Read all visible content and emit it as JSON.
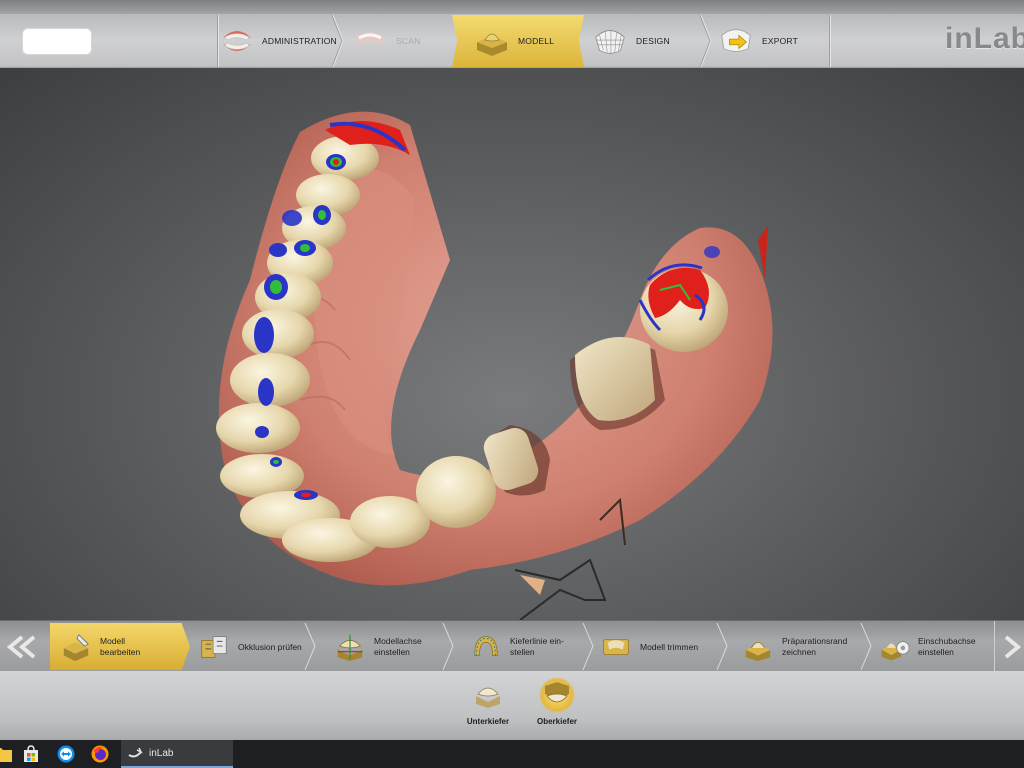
{
  "app": {
    "brand": "inLab"
  },
  "workflow": {
    "steps": [
      {
        "label": "ADMINISTRATION",
        "icon": "dentures-icon",
        "state": "normal"
      },
      {
        "label": "SCAN",
        "icon": "scan-icon",
        "state": "disabled"
      },
      {
        "label": "MODELL",
        "icon": "model-icon",
        "state": "active"
      },
      {
        "label": "DESIGN",
        "icon": "design-mesh-icon",
        "state": "normal"
      },
      {
        "label": "EXPORT",
        "icon": "export-icon",
        "state": "normal"
      }
    ]
  },
  "tools": {
    "items": [
      {
        "label": "Modell\nbearbeiten",
        "icon": "edit-model-icon",
        "state": "active"
      },
      {
        "label": "Okklusion prüfen",
        "icon": "occlusion-icon",
        "state": "normal"
      },
      {
        "label": "Modellachse\neinstellen",
        "icon": "model-axis-icon",
        "state": "normal"
      },
      {
        "label": "Kieferlinie ein-\nstellen",
        "icon": "jaw-line-icon",
        "state": "normal"
      },
      {
        "label": "Modell trimmen",
        "icon": "trim-model-icon",
        "state": "normal"
      },
      {
        "label": "Präparationsrand\nzeichnen",
        "icon": "preparation-margin-icon",
        "state": "normal"
      },
      {
        "label": "Einschubachse\neinstellen",
        "icon": "insertion-axis-icon",
        "state": "normal"
      }
    ]
  },
  "jaws": [
    {
      "label": "Unterkiefer",
      "icon": "lower-jaw-icon",
      "state": "normal"
    },
    {
      "label": "Oberkiefer",
      "icon": "upper-jaw-icon",
      "state": "active"
    }
  ],
  "taskbar": {
    "app_label": "inLab",
    "icons": [
      "file-explorer-icon",
      "store-icon",
      "teamviewer-icon",
      "firefox-icon"
    ]
  },
  "colors": {
    "accent": "#e2bb45",
    "gingiva": "#c97c6e",
    "tooth": "#e9dcb6",
    "contact_red": "#e0201a",
    "contact_blue": "#2a35c8",
    "contact_green": "#2fbf3a"
  }
}
